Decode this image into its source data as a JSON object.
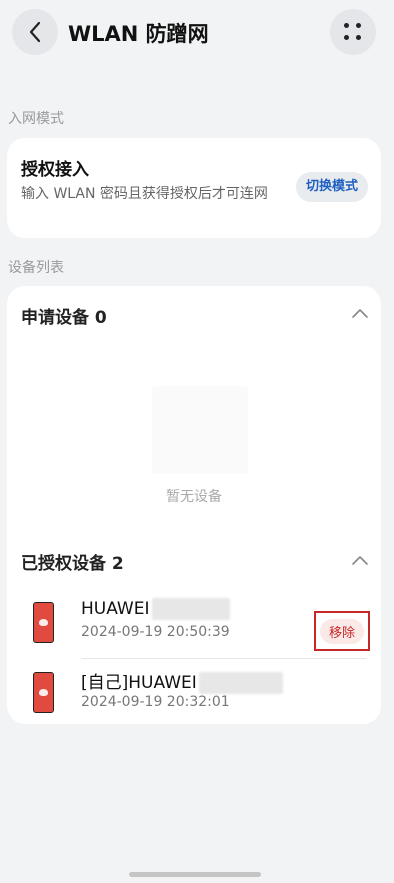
{
  "header": {
    "title": "WLAN 防蹭网"
  },
  "mode_section": {
    "label": "入网模式",
    "title": "授权接入",
    "description": "输入 WLAN 密码且获得授权后才可连网",
    "switch_label": "切换模式"
  },
  "device_section": {
    "label": "设备列表",
    "pending": {
      "title": "申请设备 0",
      "empty_text": "暂无设备"
    },
    "authorized": {
      "title": "已授权设备 2",
      "devices": [
        {
          "name": "HUAWEI",
          "time": "2024-09-19 20:50:39",
          "action": "移除"
        },
        {
          "name": "[自己]HUAWEI",
          "time": "2024-09-19 20:32:01"
        }
      ]
    }
  },
  "colors": {
    "accent": "#1f5fbf",
    "danger": "#c62828",
    "phone": "#e04a3f"
  }
}
